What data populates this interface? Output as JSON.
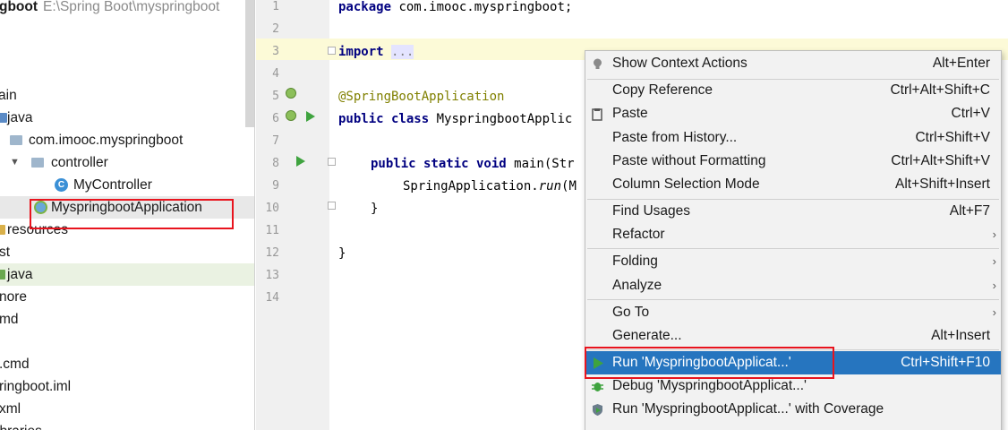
{
  "project_tree": {
    "rows": [
      {
        "label": "gboot",
        "path": "E:\\Spring Boot\\myspringboot"
      },
      {
        "label": "ain"
      },
      {
        "label": "java"
      },
      {
        "label": "com.imooc.myspringboot"
      },
      {
        "label": "controller"
      },
      {
        "label": "MyController"
      },
      {
        "label": "MyspringbootApplication"
      },
      {
        "label": "resources"
      },
      {
        "label": "st"
      },
      {
        "label": "java"
      },
      {
        "label": "nore"
      },
      {
        "label": "md"
      },
      {
        "label": ".cmd"
      },
      {
        "label": "ringboot.iml"
      },
      {
        "label": "xml"
      },
      {
        "label": "ibraries"
      }
    ]
  },
  "editor": {
    "line_numbers": [
      "1",
      "2",
      "3",
      "4",
      "5",
      "6",
      "7",
      "8",
      "9",
      "10",
      "11",
      "12",
      "13",
      "14"
    ],
    "code": {
      "l1_kw": "package",
      "l1_rest": " com.imooc.myspringboot;",
      "l3_kw": "import",
      "l3_dots": "...",
      "l6_ann": "@SpringBootApplication",
      "l7_kw": "public class",
      "l7_rest": " MyspringbootApplic",
      "l9_kw": "public static void",
      "l9_rest": " main(Str",
      "l10_rest": "SpringApplication.",
      "l10_run": "run",
      "l10_tail": "(M",
      "l11": "}",
      "l13": "}"
    }
  },
  "context_menu": {
    "items": [
      {
        "label": "Show Context Actions",
        "shortcut": "Alt+Enter",
        "icon": "lightbulb-icon"
      },
      {
        "label": "Copy Reference",
        "shortcut": "Ctrl+Alt+Shift+C"
      },
      {
        "label": "Paste",
        "shortcut": "Ctrl+V",
        "icon": "clipboard-icon"
      },
      {
        "label": "Paste from History...",
        "shortcut": "Ctrl+Shift+V"
      },
      {
        "label": "Paste without Formatting",
        "shortcut": "Ctrl+Alt+Shift+V"
      },
      {
        "label": "Column Selection Mode",
        "shortcut": "Alt+Shift+Insert"
      },
      {
        "label": "Find Usages",
        "shortcut": "Alt+F7"
      },
      {
        "label": "Refactor",
        "submenu": true
      },
      {
        "label": "Folding",
        "submenu": true
      },
      {
        "label": "Analyze",
        "submenu": true
      },
      {
        "label": "Go To",
        "submenu": true
      },
      {
        "label": "Generate...",
        "shortcut": "Alt+Insert"
      },
      {
        "label": "Run 'MyspringbootApplicat...'",
        "shortcut": "Ctrl+Shift+F10",
        "icon": "run-icon",
        "selected": true
      },
      {
        "label": "Debug 'MyspringbootApplicat...'",
        "icon": "debug-icon"
      },
      {
        "label": "Run 'MyspringbootApplicat...' with Coverage",
        "icon": "coverage-icon"
      }
    ],
    "submenu_arrow": "›"
  },
  "colors": {
    "selection": "#2675bf",
    "highlight_box": "#e8141e",
    "run_green": "#3fa33f",
    "keyword": "#000080",
    "annotation": "#808000"
  }
}
